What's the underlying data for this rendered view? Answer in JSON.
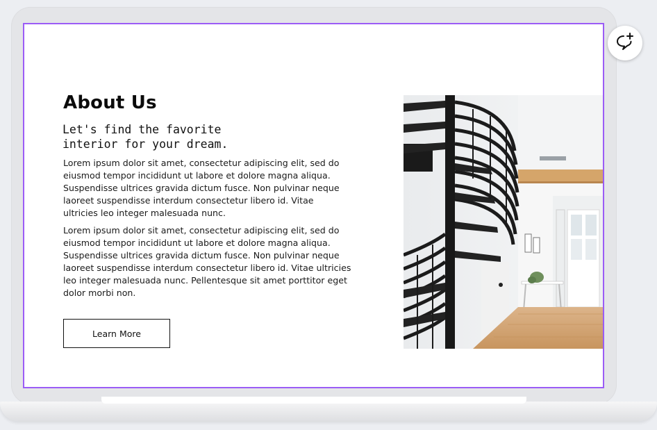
{
  "about": {
    "title": "About Us",
    "subtitle_line1": "Let's find the favorite",
    "subtitle_line2": "interior for your dream.",
    "paragraph1": "Lorem ipsum dolor sit amet, consectetur adipiscing elit, sed do eiusmod tempor incididunt ut labore et dolore magna aliqua. Suspendisse ultrices gravida dictum fusce. Non pulvinar neque laoreet suspendisse interdum consectetur libero id. Vitae ultricies leo integer malesuada nunc.",
    "paragraph2": "Lorem ipsum dolor sit amet, consectetur adipiscing elit, sed do eiusmod tempor incididunt ut labore et dolore magna aliqua. Suspendisse ultrices gravida dictum fusce. Non pulvinar neque laoreet suspendisse interdum consectetur libero id. Vitae ultricies leo integer malesuada nunc. Pellentesque sit amet porttitor eget dolor morbi non.",
    "button_label": "Learn More"
  },
  "icons": {
    "comment": "add-comment-icon",
    "photo": "spiral-staircase-photo"
  },
  "colors": {
    "selection_border": "#9b5cf6",
    "text": "#111111",
    "background": "#ffffff"
  }
}
